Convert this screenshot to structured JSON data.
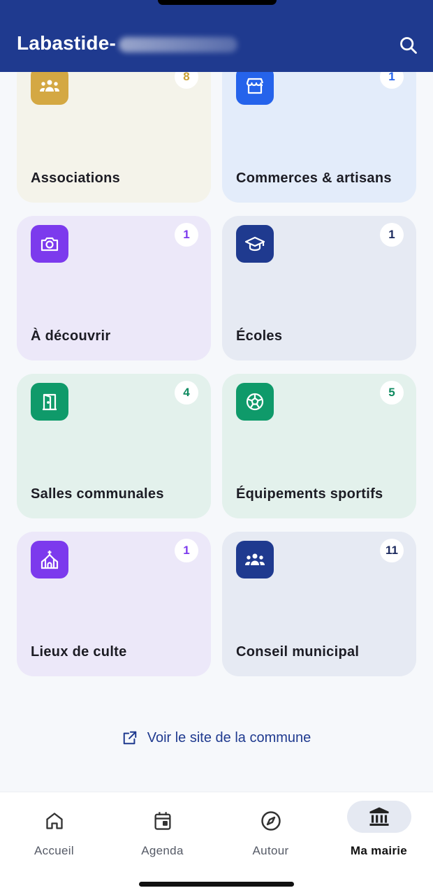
{
  "header": {
    "title": "Labastide-",
    "search_icon": "search-icon"
  },
  "cards": [
    {
      "label": "Associations",
      "count": "8",
      "icon": "people-group-icon",
      "accent": "#d4a843",
      "bg": "#f4f3ea",
      "count_color": "#c9a034"
    },
    {
      "label": "Commerces & artisans",
      "count": "1",
      "icon": "storefront-icon",
      "accent": "#2563eb",
      "bg": "#e3ecfa",
      "count_color": "#2563eb"
    },
    {
      "label": "À découvrir",
      "count": "1",
      "icon": "camera-icon",
      "accent": "#7c3aed",
      "bg": "#ece8f9",
      "count_color": "#7c3aed"
    },
    {
      "label": "Écoles",
      "count": "1",
      "icon": "graduation-cap-icon",
      "accent": "#1f3a8f",
      "bg": "#e6eaf3",
      "count_color": "#1c2a5e"
    },
    {
      "label": "Salles communales",
      "count": "4",
      "icon": "door-icon",
      "accent": "#0f9a6a",
      "bg": "#e3f1ec",
      "count_color": "#0f8a60"
    },
    {
      "label": "Équipements sportifs",
      "count": "5",
      "icon": "football-icon",
      "accent": "#0f9a6a",
      "bg": "#e3f1ec",
      "count_color": "#0f8a60"
    },
    {
      "label": "Lieux de culte",
      "count": "1",
      "icon": "church-icon",
      "accent": "#7c3aed",
      "bg": "#ece8f9",
      "count_color": "#7c3aed"
    },
    {
      "label": "Conseil municipal",
      "count": "11",
      "icon": "people-group-icon",
      "accent": "#1f3a8f",
      "bg": "#e6eaf3",
      "count_color": "#1c2a5e"
    }
  ],
  "site_link": {
    "label": "Voir le site de la commune",
    "icon": "external-link-icon"
  },
  "tabs": [
    {
      "label": "Accueil",
      "icon": "home-icon",
      "active": false
    },
    {
      "label": "Agenda",
      "icon": "calendar-icon",
      "active": false
    },
    {
      "label": "Autour",
      "icon": "compass-icon",
      "active": false
    },
    {
      "label": "Ma mairie",
      "icon": "city-hall-icon",
      "active": true
    }
  ],
  "colors": {
    "header_bg": "#1f3a8f",
    "link": "#1f3a8f"
  }
}
